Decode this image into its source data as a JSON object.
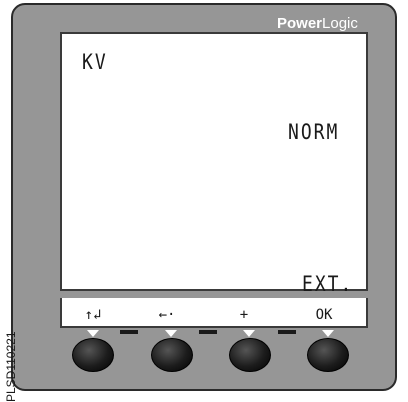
{
  "brand": {
    "part1": "Power",
    "part2": "Logic"
  },
  "display": {
    "parameter": "KV",
    "mode": "NORM",
    "option": "EXT."
  },
  "softkeys": [
    {
      "label": "↑↲",
      "icon": "up-enter-icon"
    },
    {
      "label": "←·",
      "icon": "left-arrow-icon"
    },
    {
      "label": "+",
      "icon": "plus-icon"
    },
    {
      "label": "OK",
      "icon": ""
    }
  ],
  "image_code": "PLSD110221",
  "colors": {
    "housing": "#969696",
    "screen": "#ffffff",
    "button": "#1c1c1c"
  }
}
